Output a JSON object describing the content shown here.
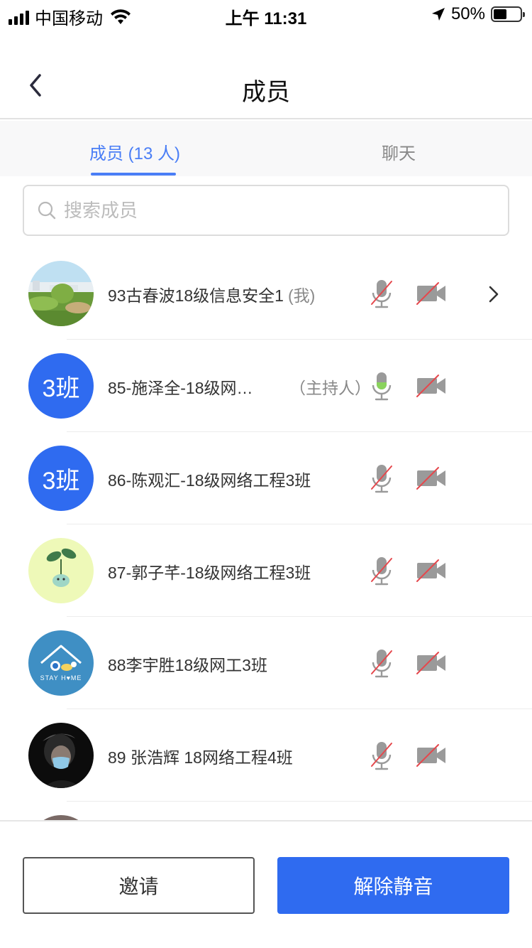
{
  "status_bar": {
    "carrier": "中国移动",
    "time": "上午 11:31",
    "battery": "50%",
    "battery_level": 0.5,
    "icons": [
      "signal-icon",
      "wifi-icon",
      "location-arrow-icon",
      "battery-icon"
    ]
  },
  "nav": {
    "title": "成员",
    "back_icon": "chevron-left-icon"
  },
  "tabs": [
    {
      "label": "成员 (13 人)",
      "active": true
    },
    {
      "label": "聊天",
      "active": false
    }
  ],
  "search": {
    "placeholder": "搜索成员",
    "value": ""
  },
  "colors": {
    "accent": "#2f6bf0",
    "tab_active": "#4a7ef6",
    "muted_slash": "#e5484d",
    "mic_active": "#8ad35c",
    "icon_gray": "#9a9a9a"
  },
  "members": [
    {
      "name": "93古春波18级信息安全1",
      "suffix": "(我)",
      "avatar": "campus-photo-avatar",
      "mic": "muted",
      "camera": "off",
      "has_chevron": true
    },
    {
      "name": "85-施泽全-18级网…",
      "role": "（主持人）",
      "avatar_text": "3班",
      "mic": "on",
      "camera": "off"
    },
    {
      "name": "86-陈观汇-18级网络工程3班",
      "avatar_text": "3班",
      "mic": "muted",
      "camera": "off"
    },
    {
      "name": "87-郭子芊-18级网络工程3班",
      "avatar": "plant-cartoon-avatar",
      "mic": "muted",
      "camera": "off"
    },
    {
      "name": "88李宇胜18级网工3班",
      "avatar": "stay-home-avatar",
      "avatar_caption": "STAY H♥ME",
      "mic": "muted",
      "camera": "off"
    },
    {
      "name": "89 张浩辉 18网络工程4班",
      "avatar": "masked-person-avatar",
      "mic": "muted",
      "camera": "off"
    }
  ],
  "bottom": {
    "invite_label": "邀请",
    "unmute_label": "解除静音"
  }
}
